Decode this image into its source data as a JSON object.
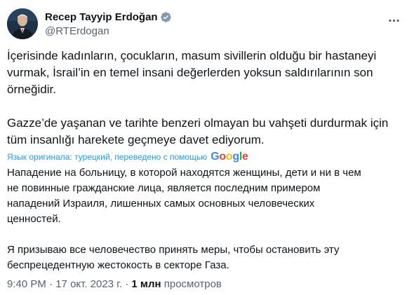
{
  "author": {
    "display_name": "Recep Tayyip Erdoğan",
    "handle": "@RTErdogan",
    "verified": true,
    "verified_color": "#1d9bf0"
  },
  "tweet": {
    "original_text": "İçerisinde kadınların, çocukların, masum sivillerin olduğu bir hastaneyi\nvurmak, İsrail’in en temel insani değerlerden yoksun saldırılarının son\nörneğidir.\n\nGazze’de yaşanan ve tarihte benzeri olmayan bu vahşeti durdurmak için\ntüm insanlığı harekete geçmeye davet ediyorum.",
    "translation_note": "Язык оригинала: турецкий, переведено с помощью",
    "translation_provider": "Google",
    "translated_text": "Нападение на больницу, в которой находятся женщины, дети и ни в чем\nне повинные гражданские лица, является последним примером\nнападений Израиля, лишенных самых основных человеческих\nценностей.\n\nЯ призываю все человечество принять меры, чтобы остановить эту\nбеспрецедентную жестокость в секторе Газа."
  },
  "meta": {
    "time": "9:40 PM",
    "separator": "·",
    "date": "17 окт. 2023 г.",
    "views_count": "1 млн",
    "views_label": "просмотров"
  },
  "icons": {
    "more": "more-horizontal-icon",
    "verified": "verified-badge-icon"
  },
  "colors": {
    "text_primary": "#0f1419",
    "text_secondary": "#536471",
    "link": "#1d9bf0"
  }
}
